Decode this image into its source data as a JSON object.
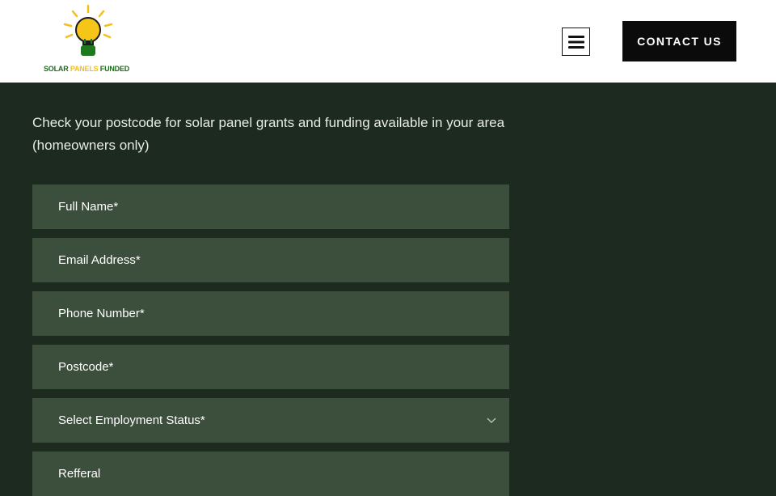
{
  "logo": {
    "word1": "SOLAR ",
    "word2": "PANELS ",
    "word3": "FUNDED"
  },
  "header": {
    "contact_label": "CONTACT US"
  },
  "intro": {
    "text": "Check your postcode for solar panel grants and funding available in your area (homeowners only)"
  },
  "form": {
    "full_name": {
      "placeholder": "Full Name*"
    },
    "email": {
      "placeholder": "Email Address*"
    },
    "phone": {
      "placeholder": "Phone Number*"
    },
    "postcode": {
      "placeholder": "Postcode*"
    },
    "employment": {
      "selected": "Select Employment Status*"
    },
    "referral": {
      "placeholder": "Refferal"
    }
  },
  "colors": {
    "background": "#1c2a1f",
    "field": "#3c4e3c",
    "button": "#0b0b0b",
    "logo_green": "#1f6a1c",
    "logo_yellow": "#f2c01b"
  },
  "icons": [
    "lightbulb-logo-icon",
    "hamburger-menu-icon",
    "chevron-down-icon"
  ]
}
